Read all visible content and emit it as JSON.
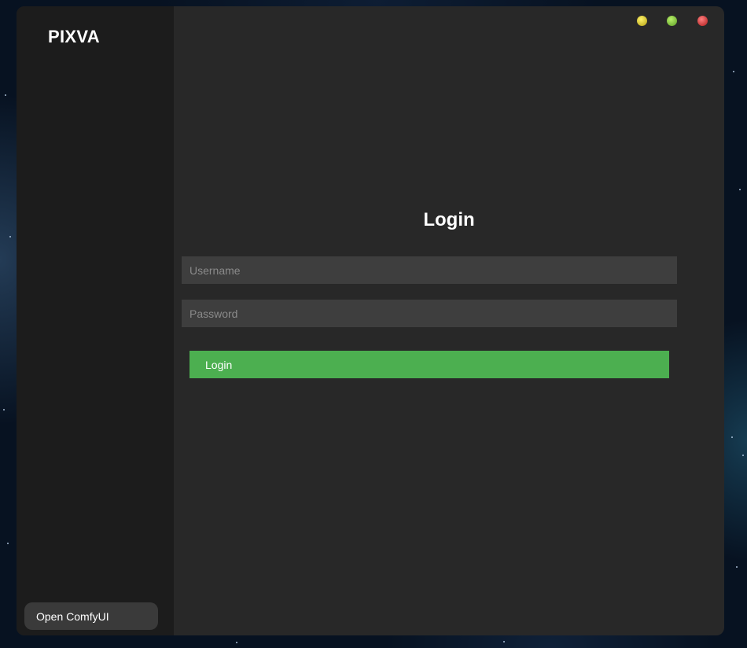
{
  "app": {
    "brand": "PIXVA"
  },
  "sidebar": {
    "open_comfyui_label": "Open ComfyUI"
  },
  "window_controls": {
    "minimize_color": "#e0d040",
    "maximize_color": "#90d050",
    "close_color": "#e04848"
  },
  "login": {
    "title": "Login",
    "username_placeholder": "Username",
    "password_placeholder": "Password",
    "button_label": "Login",
    "button_color": "#4caf50"
  }
}
